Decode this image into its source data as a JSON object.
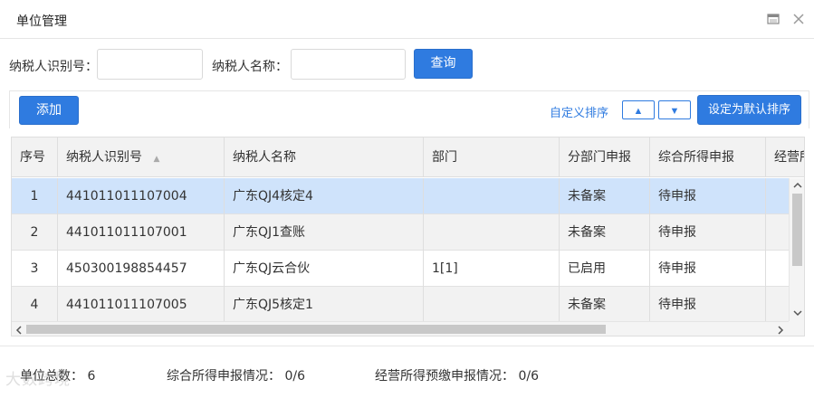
{
  "window": {
    "title": "单位管理"
  },
  "search": {
    "taxpayer_id_label": "纳税人识别号：",
    "taxpayer_id_value": "",
    "taxpayer_name_label": "纳税人名称：",
    "taxpayer_name_value": "",
    "query_label": "查询"
  },
  "toolbar": {
    "add_label": "添加",
    "custom_sort_label": "自定义排序",
    "up_label": "▲",
    "down_label": "▼",
    "set_default_label": "设定为默认排序"
  },
  "table": {
    "columns": [
      "序号",
      "纳税人识别号",
      "纳税人名称",
      "部门",
      "分部门申报",
      "综合所得申报",
      "经营所"
    ],
    "sort_indicator": "▲",
    "rows": [
      [
        "1",
        "441011011107004",
        "广东QJ4核定4",
        "",
        "未备案",
        "待申报",
        ""
      ],
      [
        "2",
        "441011011107001",
        "广东QJ1查账",
        "",
        "未备案",
        "待申报",
        ""
      ],
      [
        "3",
        "450300198854457",
        "广东QJ云合伙",
        "1[1]",
        "已启用",
        "待申报",
        ""
      ],
      [
        "4",
        "441011011107005",
        "广东QJ5核定1",
        "",
        "未备案",
        "待申报",
        ""
      ]
    ]
  },
  "footer": {
    "total_units": "单位总数： 6",
    "comprehensive_status": "综合所得申报情况： 0/6",
    "business_status": "经营所得预缴申报情况： 0/6"
  },
  "watermark": "大数跨境",
  "colors": {
    "primary": "#2f7be0",
    "selected_row": "#cfe3fb",
    "header_bg": "#f2f2f2"
  }
}
